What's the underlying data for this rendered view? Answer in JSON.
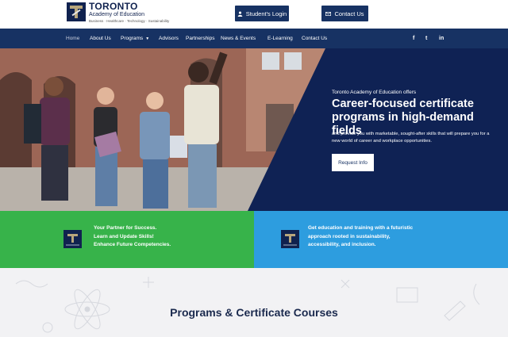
{
  "header": {
    "logo": {
      "name": "TORONTO",
      "subtitle": "Academy of Education",
      "tagline": "Business · Healthcare · Technology · Sustainability"
    },
    "login_label": "Student's Login",
    "contact_label": "Contact Us"
  },
  "nav": {
    "items": [
      {
        "label": "Home"
      },
      {
        "label": "About Us"
      },
      {
        "label": "Programs"
      },
      {
        "label": "Advisors"
      },
      {
        "label": "Partnerships"
      },
      {
        "label": "News & Events"
      },
      {
        "label": "E-Learning"
      },
      {
        "label": "Contact Us"
      }
    ],
    "social": [
      "facebook-icon",
      "twitter-icon",
      "linkedin-icon"
    ],
    "social_glyphs": [
      "f",
      "t",
      "in"
    ]
  },
  "hero": {
    "kicker": "Toronto Academy of Education offers",
    "title": "Career-focused certificate programs in high-demand fields",
    "description": "and provide you with marketable, sought-after skills that will prepare you for a new world of career and workplace opportunities.",
    "button_label": "Request Info"
  },
  "features": [
    {
      "lines": [
        "Your Partner for Success.",
        "Learn and Update Skills!",
        "Enhance Future Competencies."
      ]
    },
    {
      "lines": [
        "Get education and training with a futuristic",
        "approach rooted in sustainability,",
        "accessibility, and inclusion."
      ]
    }
  ],
  "programs": {
    "title": "Programs & Certificate Courses"
  },
  "colors": {
    "navy": "#173263",
    "hero_panel": "#0f2254",
    "green": "#37b34a",
    "blue": "#2d9ddf",
    "gold": "#b8a67c"
  }
}
